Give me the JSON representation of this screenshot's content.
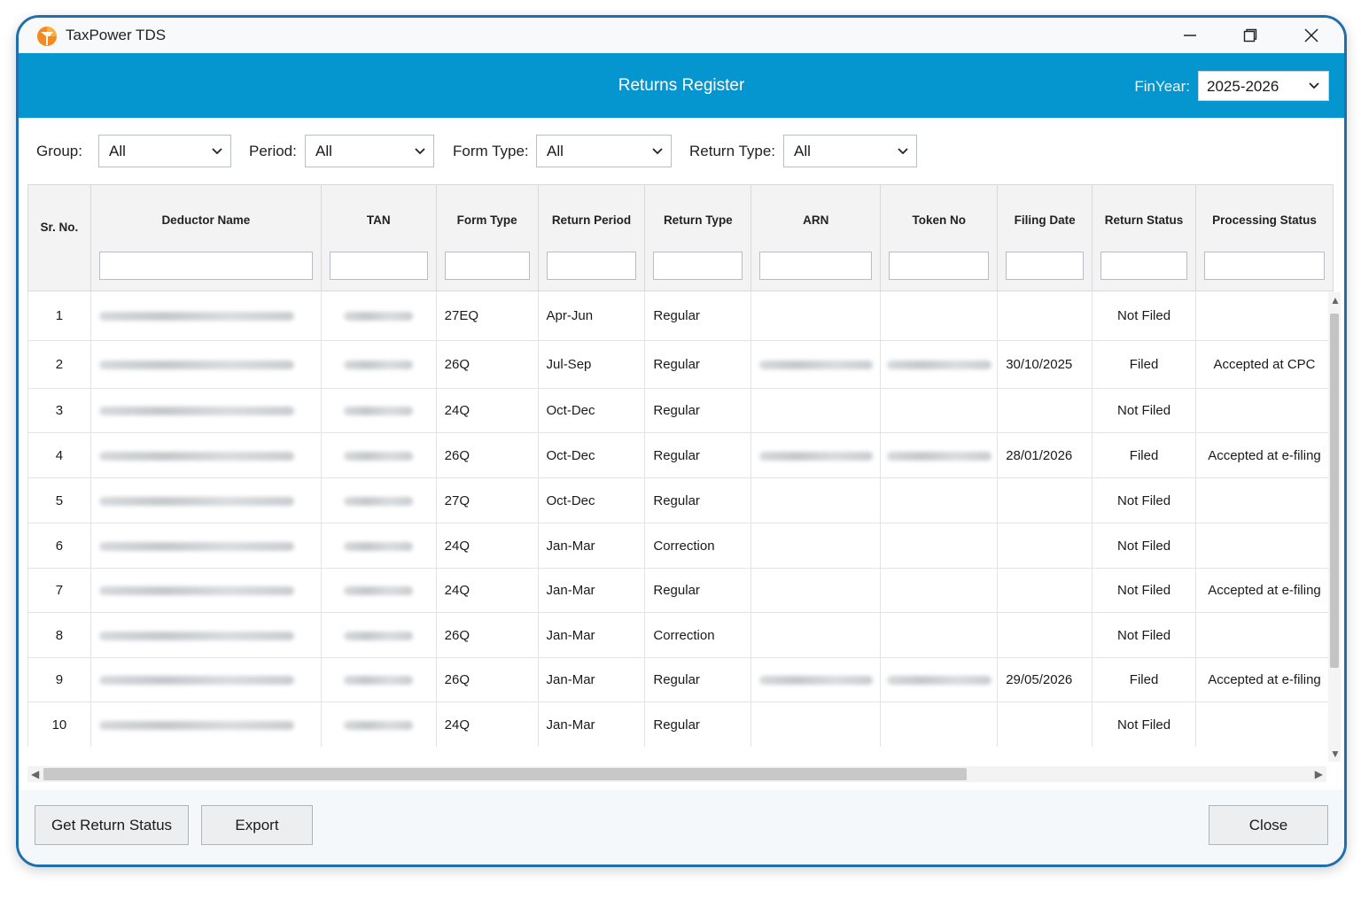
{
  "window": {
    "title": "TaxPower TDS"
  },
  "banner": {
    "title": "Returns Register",
    "finyear_label": "FinYear:",
    "finyear_value": "2025-2026"
  },
  "filters": {
    "group_label": "Group:",
    "group_value": "All",
    "period_label": "Period:",
    "period_value": "All",
    "formtype_label": "Form Type:",
    "formtype_value": "All",
    "returntype_label": "Return Type:",
    "returntype_value": "All"
  },
  "table": {
    "columns": [
      "Sr. No.",
      "Deductor Name",
      "TAN",
      "Form Type",
      "Return Period",
      "Return Type",
      "ARN",
      "Token No",
      "Filing Date",
      "Return Status",
      "Processing Status"
    ],
    "rows": [
      {
        "sr": "1",
        "form": "27EQ",
        "period": "Apr-Jun",
        "type": "Regular",
        "arn": false,
        "filing_date": "",
        "status": "Not Filed",
        "processing": ""
      },
      {
        "sr": "2",
        "form": "26Q",
        "period": "Jul-Sep",
        "type": "Regular",
        "arn": true,
        "filing_date": "30/10/2025",
        "status": "Filed",
        "processing": "Accepted at CPC"
      },
      {
        "sr": "3",
        "form": "24Q",
        "period": "Oct-Dec",
        "type": "Regular",
        "arn": false,
        "filing_date": "",
        "status": "Not Filed",
        "processing": ""
      },
      {
        "sr": "4",
        "form": "26Q",
        "period": "Oct-Dec",
        "type": "Regular",
        "arn": true,
        "filing_date": "28/01/2026",
        "status": "Filed",
        "processing": "Accepted at e-filing"
      },
      {
        "sr": "5",
        "form": "27Q",
        "period": "Oct-Dec",
        "type": "Regular",
        "arn": false,
        "filing_date": "",
        "status": "Not Filed",
        "processing": ""
      },
      {
        "sr": "6",
        "form": "24Q",
        "period": "Jan-Mar",
        "type": "Correction",
        "arn": false,
        "filing_date": "",
        "status": "Not Filed",
        "processing": ""
      },
      {
        "sr": "7",
        "form": "24Q",
        "period": "Jan-Mar",
        "type": "Regular",
        "arn": false,
        "filing_date": "",
        "status": "Not Filed",
        "processing": "Accepted at e-filing"
      },
      {
        "sr": "8",
        "form": "26Q",
        "period": "Jan-Mar",
        "type": "Correction",
        "arn": false,
        "filing_date": "",
        "status": "Not Filed",
        "processing": ""
      },
      {
        "sr": "9",
        "form": "26Q",
        "period": "Jan-Mar",
        "type": "Regular",
        "arn": true,
        "filing_date": "29/05/2026",
        "status": "Filed",
        "processing": "Accepted at e-filing"
      },
      {
        "sr": "10",
        "form": "24Q",
        "period": "Jan-Mar",
        "type": "Regular",
        "arn": false,
        "filing_date": "",
        "status": "Not Filed",
        "processing": ""
      }
    ]
  },
  "footer": {
    "get_status_label": "Get Return Status",
    "export_label": "Export",
    "close_label": "Close"
  },
  "icons": {
    "app": "taxpower-logo-icon",
    "minimize": "minimize-icon",
    "restore": "restore-icon",
    "close": "close-icon",
    "dropdown": "chevron-down-icon"
  },
  "colors": {
    "banner": "#0595cf",
    "window_border": "#1f6fae"
  }
}
